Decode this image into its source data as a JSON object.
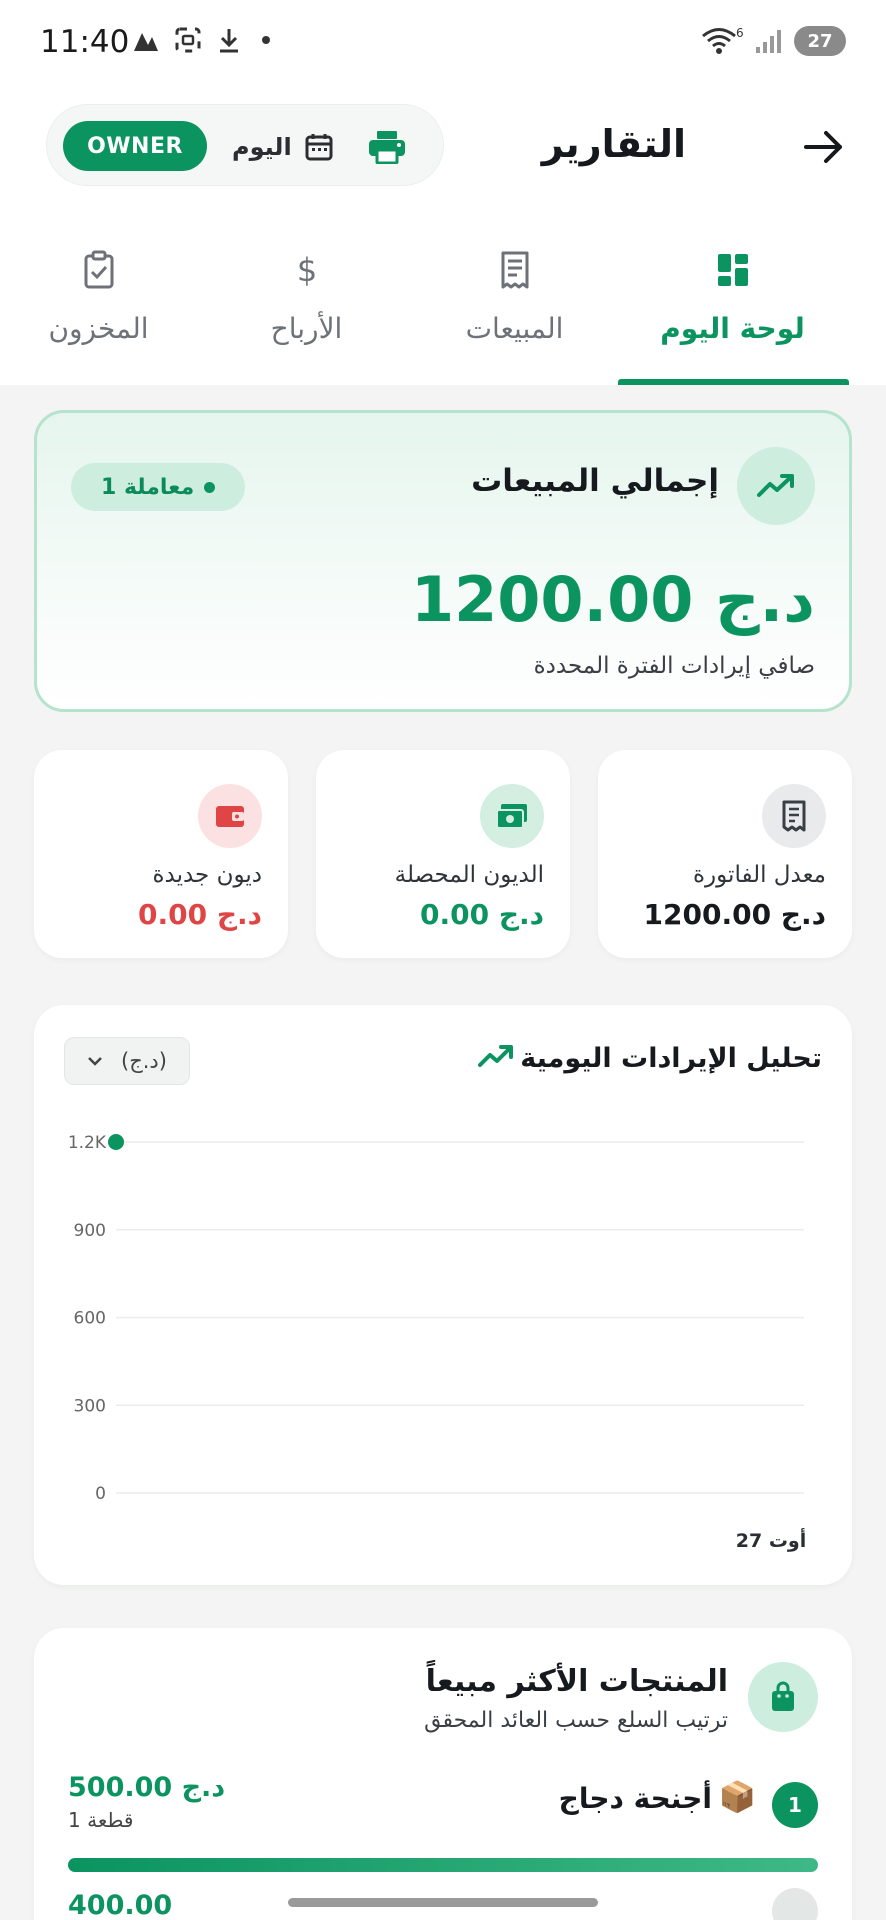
{
  "status_bar": {
    "time": "11:40",
    "signal_badge": "6",
    "battery": "27"
  },
  "header": {
    "title": "التقارير",
    "owner_badge": "OWNER",
    "date_label": "اليوم"
  },
  "tabs": [
    {
      "label": "لوحة اليوم",
      "icon": "dashboard-icon",
      "active": true
    },
    {
      "label": "المبيعات",
      "icon": "receipt-icon",
      "active": false
    },
    {
      "label": "الأرباح",
      "icon": "dollar-icon",
      "active": false
    },
    {
      "label": "المخزون",
      "icon": "clipboard-check-icon",
      "active": false
    }
  ],
  "hero": {
    "title": "إجمالي المبيعات",
    "transactions": "1 معاملة",
    "amount": "1200.00 د.ج",
    "subtitle": "صافي إيرادات الفترة المحددة"
  },
  "stats": [
    {
      "label": "معدل الفاتورة",
      "value": "1200.00 د.ج",
      "color": "#16191d"
    },
    {
      "label": "الديون المحصلة",
      "value": "0.00 د.ج",
      "color": "#0b9460"
    },
    {
      "label": "ديون جديدة",
      "value": "0.00 د.ج",
      "color": "#e04545"
    }
  ],
  "chart_card": {
    "title": "تحليل الإيرادات اليومية",
    "currency": "(د.ج)"
  },
  "chart_data": {
    "type": "line",
    "title": "تحليل الإيرادات اليومية",
    "x": [
      "27 أوت"
    ],
    "series": [
      {
        "values": [
          1200
        ]
      }
    ],
    "yticks": [
      "0",
      "300",
      "600",
      "900",
      "1.2K"
    ],
    "ylim": [
      0,
      1200
    ],
    "grid": true,
    "color": "#0b9460"
  },
  "products": {
    "title": "المنتجات الأكثر مبيعاً",
    "subtitle": "ترتيب السلع حسب العائد المحقق",
    "items": [
      {
        "rank": "1",
        "emoji": "📦",
        "name": "أجنحة دجاج",
        "amount": "500.00 د.ج",
        "qty": "1 قطعة",
        "share": 1.0
      }
    ],
    "next_partial": "400.00"
  }
}
